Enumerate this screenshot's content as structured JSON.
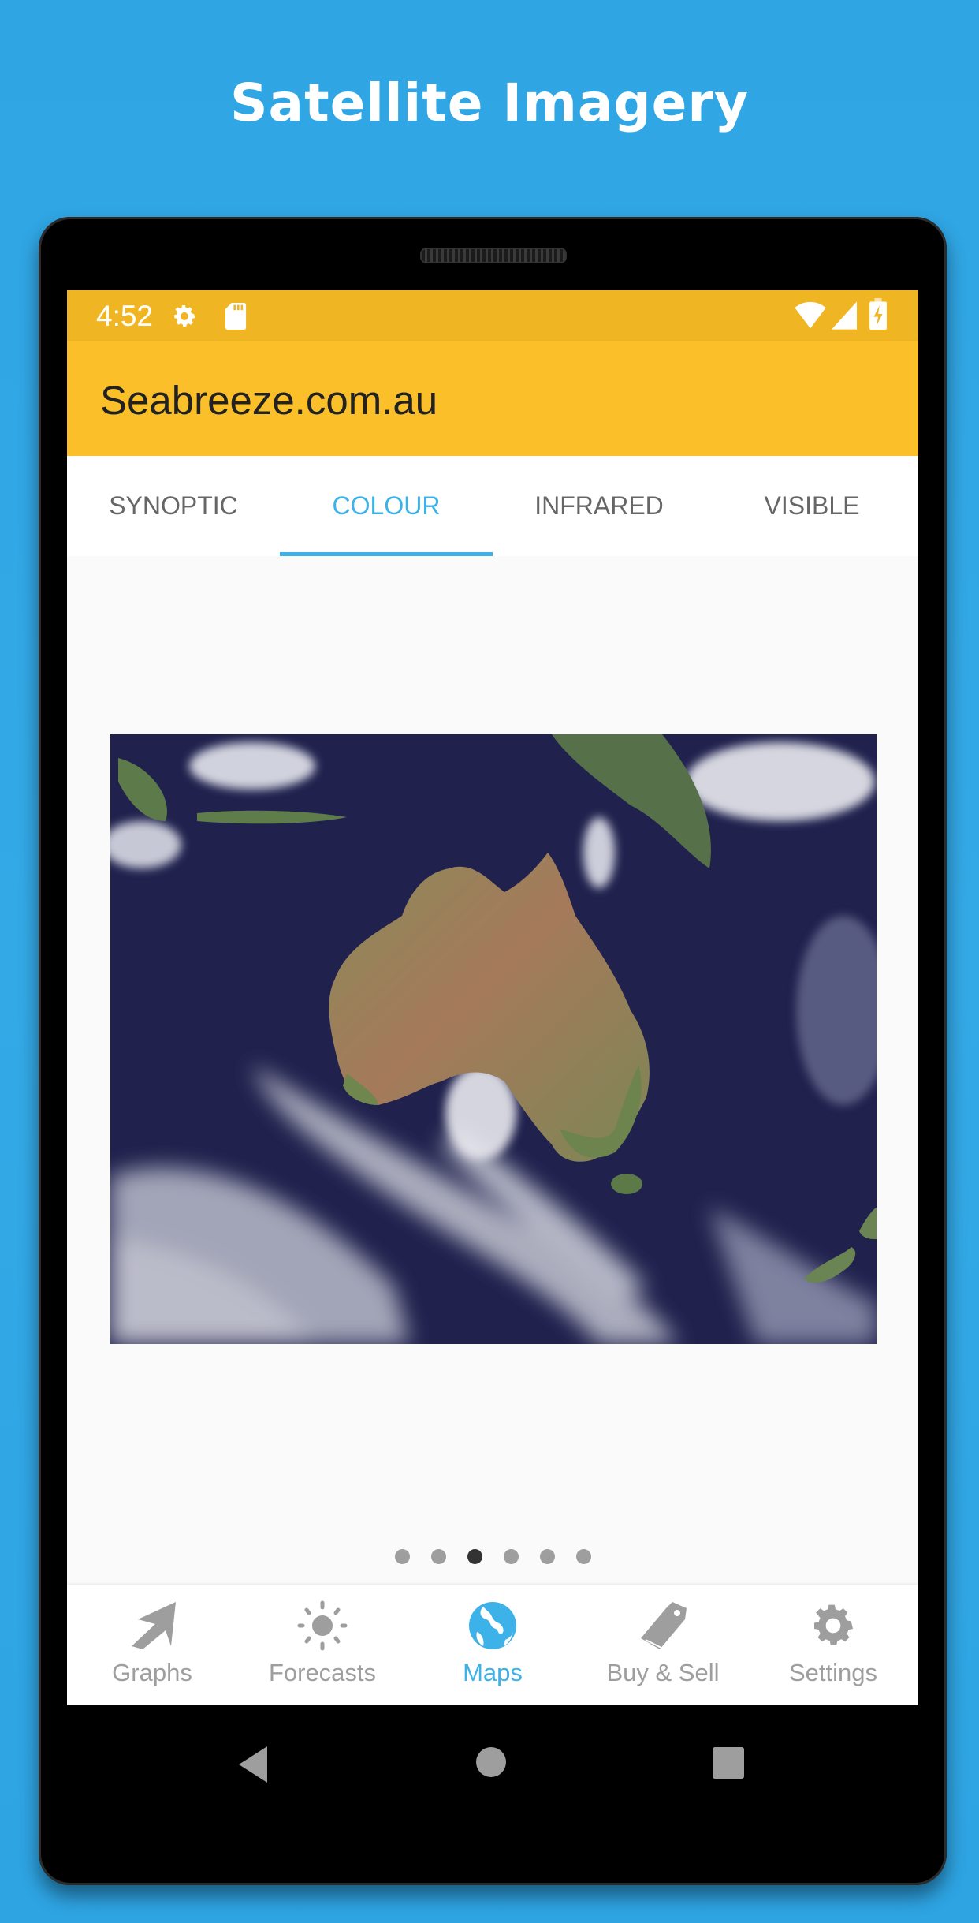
{
  "promo": {
    "title": "Satellite Imagery"
  },
  "status_bar": {
    "time": "4:52",
    "left_icons": [
      "gear-icon",
      "sd-card-icon"
    ],
    "right_icons": [
      "wifi-icon",
      "cell-signal-icon",
      "battery-charging-icon"
    ]
  },
  "app_bar": {
    "title": "Seabreeze.com.au",
    "color": "#fbbf2a"
  },
  "tabs": {
    "active_index": 1,
    "accent": "#3db2e8",
    "items": [
      {
        "label": "SYNOPTIC"
      },
      {
        "label": "COLOUR"
      },
      {
        "label": "INFRARED"
      },
      {
        "label": "VISIBLE"
      }
    ]
  },
  "content": {
    "image": "satellite-colour-australia",
    "pager": {
      "count": 6,
      "active_index": 2
    }
  },
  "bottom_nav": {
    "active_index": 2,
    "items": [
      {
        "label": "Graphs",
        "icon": "arrow-icon"
      },
      {
        "label": "Forecasts",
        "icon": "sun-icon"
      },
      {
        "label": "Maps",
        "icon": "globe-icon"
      },
      {
        "label": "Buy & Sell",
        "icon": "tag-icon"
      },
      {
        "label": "Settings",
        "icon": "gear-icon"
      }
    ]
  },
  "system_nav": [
    "back-button",
    "home-button",
    "recents-button"
  ]
}
